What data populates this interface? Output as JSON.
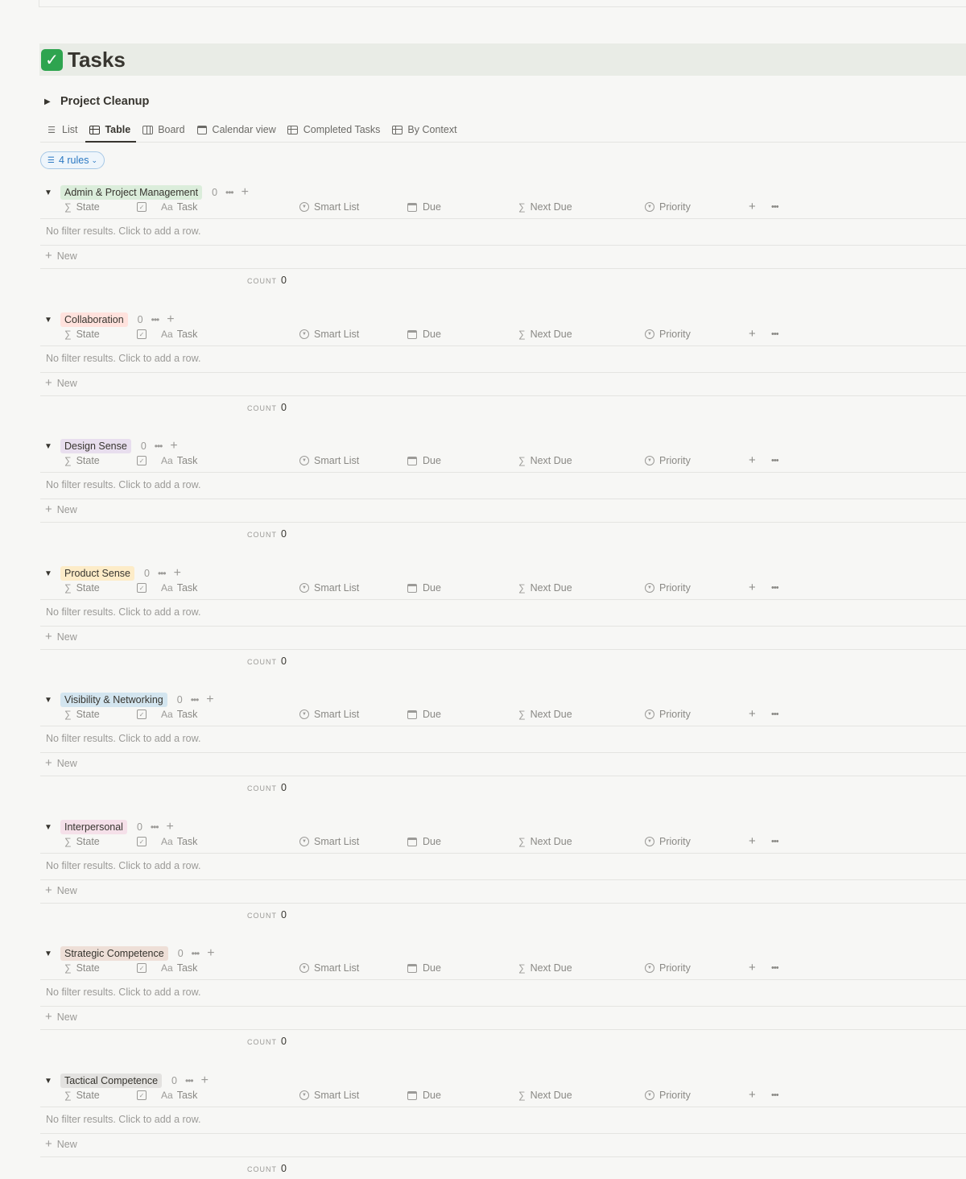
{
  "page": {
    "title": "Tasks",
    "title_icon": "check-mark-icon",
    "toggle": "Project Cleanup"
  },
  "tabs": [
    {
      "label": "List",
      "icon": "list-icon"
    },
    {
      "label": "Table",
      "icon": "table-icon",
      "active": true
    },
    {
      "label": "Board",
      "icon": "board-icon"
    },
    {
      "label": "Calendar view",
      "icon": "calendar-icon"
    },
    {
      "label": "Completed Tasks",
      "icon": "table-icon"
    },
    {
      "label": "By Context",
      "icon": "table-icon"
    }
  ],
  "filter": {
    "label": "4 rules"
  },
  "columns": {
    "state": "State",
    "task_prefix": "Aa",
    "task": "Task",
    "smart_list": "Smart List",
    "due": "Due",
    "next_due": "Next Due",
    "priority": "Priority"
  },
  "empty_text": "No filter results. Click to add a row.",
  "new_label": "New",
  "count_label": "COUNT",
  "groups": [
    {
      "name": "Admin & Project Management",
      "count": "0",
      "color": "#dbeddb",
      "sum": "0"
    },
    {
      "name": "Collaboration",
      "count": "0",
      "color": "#ffe2dd",
      "sum": "0"
    },
    {
      "name": "Design Sense",
      "count": "0",
      "color": "#e8deee",
      "sum": "0"
    },
    {
      "name": "Product Sense",
      "count": "0",
      "color": "#fdecc8",
      "sum": "0"
    },
    {
      "name": "Visibility & Networking",
      "count": "0",
      "color": "#d3e5ef",
      "sum": "0"
    },
    {
      "name": "Interpersonal",
      "count": "0",
      "color": "#f5e0e9",
      "sum": "0"
    },
    {
      "name": "Strategic Competence",
      "count": "0",
      "color": "#eedfd7",
      "sum": "0"
    },
    {
      "name": "Tactical Competence",
      "count": "0",
      "color": "#e3e2e0",
      "sum": "0"
    }
  ]
}
